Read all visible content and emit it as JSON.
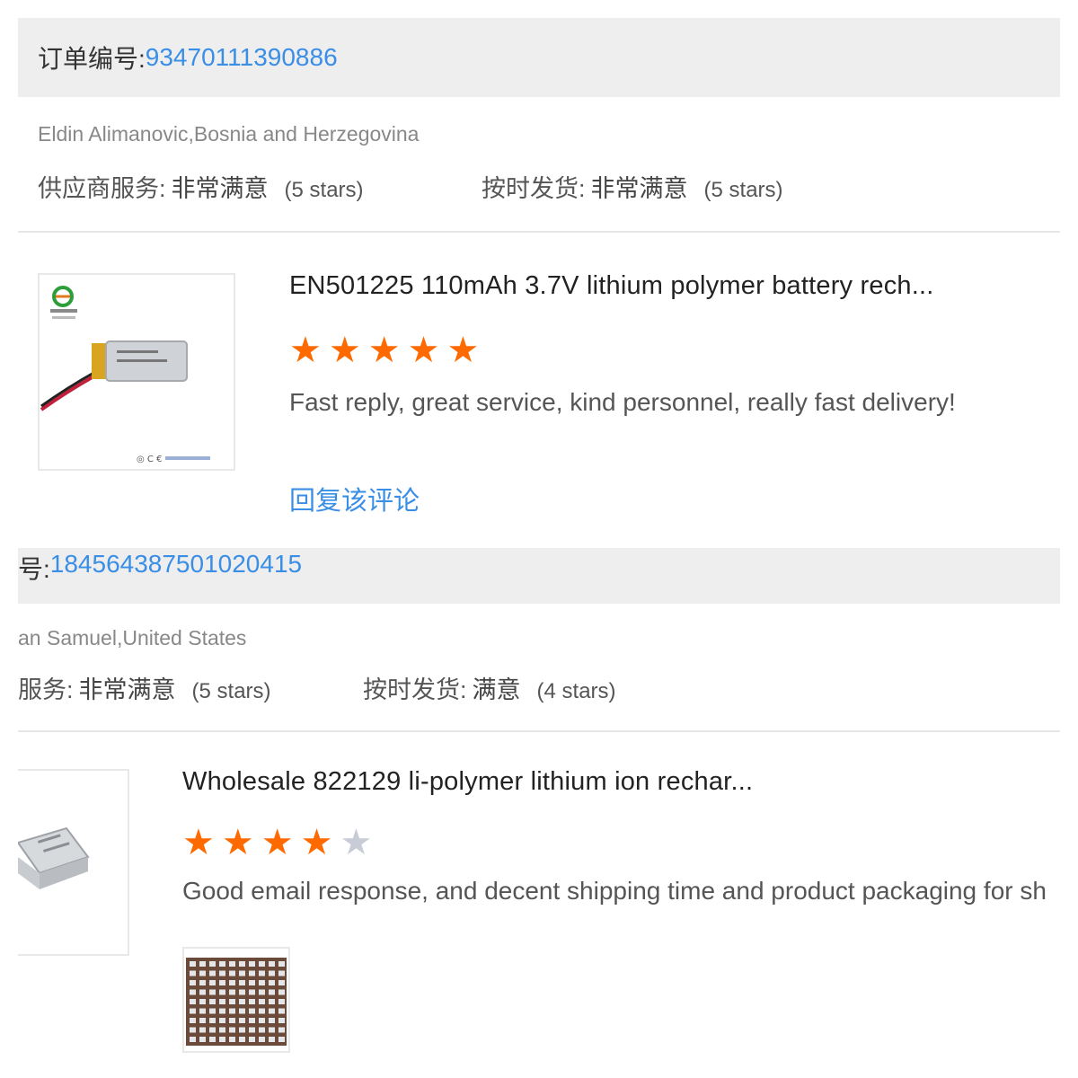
{
  "reviews": [
    {
      "order_label": "订单编号:",
      "order_number": "93470111390886",
      "buyer": "Eldin Alimanovic,Bosnia and Herzegovina",
      "supplier_service_label": "供应商服务:",
      "supplier_service_value": "非常满意",
      "supplier_service_stars": "(5 stars)",
      "shipping_label": "按时发货:",
      "shipping_value": "非常满意",
      "shipping_stars": "(5 stars)",
      "product_title": "EN501225 110mAh 3.7V lithium polymer battery rech...",
      "rating": 5,
      "review_text": "Fast reply, great service, kind personnel, really fast delivery!",
      "reply_label": "回复该评论"
    },
    {
      "order_label": "号:",
      "order_number": "184564387501020415",
      "buyer": "an Samuel,United States",
      "supplier_service_label": "服务:",
      "supplier_service_value": "非常满意",
      "supplier_service_stars": "(5 stars)",
      "shipping_label": "按时发货:",
      "shipping_value": "满意",
      "shipping_stars": "(4 stars)",
      "product_title": "Wholesale 822129 li-polymer lithium ion rechar...",
      "rating": 4,
      "review_text": "Good email response, and decent shipping time and product packaging for sh"
    }
  ],
  "icons": {
    "star_filled": "star-icon",
    "star_empty": "star-empty-icon"
  },
  "colors": {
    "link": "#3a8ee6",
    "star": "#ff6a00",
    "star_off": "#c8ccd6",
    "bar": "#eeeeee"
  }
}
